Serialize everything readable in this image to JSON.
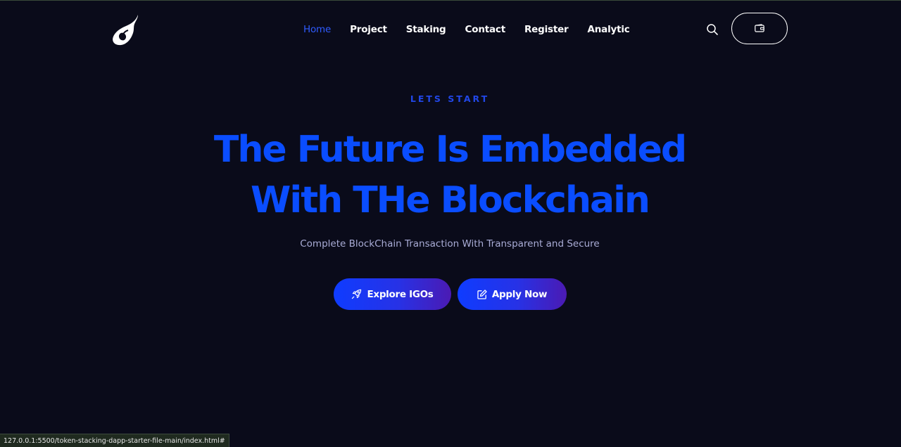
{
  "nav": {
    "items": [
      {
        "label": "Home",
        "active": true
      },
      {
        "label": "Project",
        "active": false
      },
      {
        "label": "Staking",
        "active": false
      },
      {
        "label": "Contact",
        "active": false
      },
      {
        "label": "Register",
        "active": false
      },
      {
        "label": "Analytic",
        "active": false
      }
    ]
  },
  "icons": {
    "logo": "flame-logo-icon",
    "search": "search-icon",
    "wallet": "wallet-icon",
    "explore": "rocket-icon",
    "apply": "edit-icon"
  },
  "hero": {
    "eyebrow": "LETS START",
    "headline_line1": "The Future Is Embedded",
    "headline_line2": "With THe Blockchain",
    "subtitle": "Complete BlockChain Transaction With Transparent and Secure"
  },
  "buttons": {
    "explore_label": "Explore IGOs",
    "apply_label": "Apply Now"
  },
  "status_bar": {
    "url": "127.0.0.1:5500/token-stacking-dapp-starter-file-main/index.html#"
  },
  "colors": {
    "background": "#0a0b1a",
    "accent_blue": "#0a4dff",
    "nav_active": "#2f5bff",
    "subtitle": "#a9acd6",
    "button_gradient_start": "#0f3cff",
    "button_gradient_end": "#4b1ab3"
  }
}
